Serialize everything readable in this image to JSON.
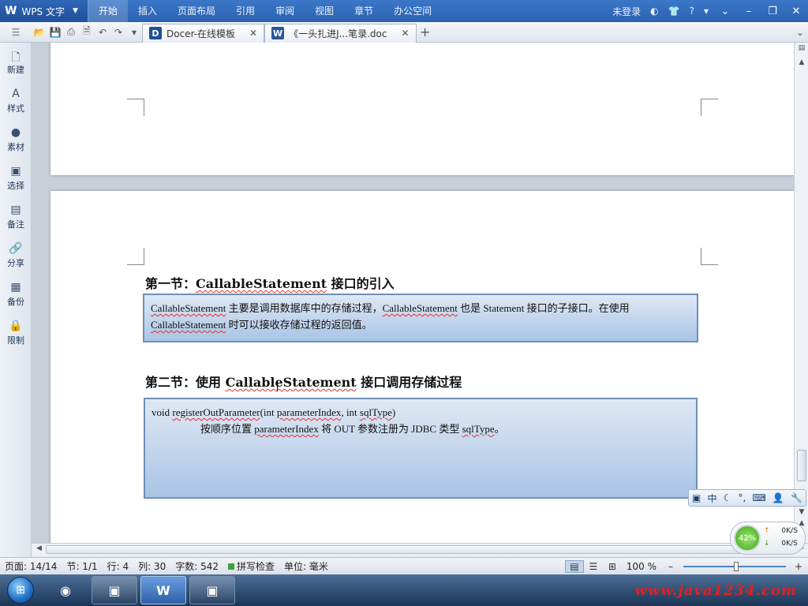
{
  "app": {
    "logo_letter": "W",
    "name": "WPS 文字",
    "menu": [
      "开始",
      "插入",
      "页面布局",
      "引用",
      "审阅",
      "视图",
      "章节",
      "办公空间"
    ],
    "active_menu": "开始",
    "login": "未登录",
    "help": "?"
  },
  "tabs": [
    {
      "icon": "D",
      "title": "Docer-在线模板"
    },
    {
      "icon": "W",
      "title": "《一头扎进J...笔录.doc"
    }
  ],
  "sidebar": [
    {
      "icon": "new-document-icon",
      "label": "新建"
    },
    {
      "icon": "style-icon",
      "label": "样式"
    },
    {
      "icon": "material-icon",
      "label": "素材"
    },
    {
      "icon": "select-icon",
      "label": "选择"
    },
    {
      "icon": "comment-icon",
      "label": "备注"
    },
    {
      "icon": "share-icon",
      "label": "分享"
    },
    {
      "icon": "backup-icon",
      "label": "备份"
    },
    {
      "icon": "restrict-icon",
      "label": "限制"
    }
  ],
  "document": {
    "section1": {
      "heading_prefix": "第一节：",
      "heading_term": "CallableStatement",
      "heading_suffix": " 接口的引入",
      "line1_term": "CallableStatement",
      "line1_a": " 主要是调用数据库中的存储过程，",
      "line1_term2": "CallableStatement",
      "line1_b": " 也是 Statement 接口的子接口。在使用",
      "line2_term": "CallableStatement",
      "line2_a": " 时可以接收存储过程的返回值。"
    },
    "section2": {
      "heading_prefix": "第二节：使用 ",
      "heading_term": "CallableStatement",
      "heading_suffix": " 接口调用存储过程",
      "sig_a": "void ",
      "sig_method": "registerOutParameter",
      "sig_b": "(int ",
      "sig_param": "parameterIndex",
      "sig_c": ", int ",
      "sig_type": "sqlType",
      "sig_d": ")",
      "desc_a": "按顺序位置  ",
      "desc_param": "parameterIndex",
      "desc_b": "  将  OUT  参数注册为  JDBC  类型  ",
      "desc_type": "sqlType",
      "desc_c": "。"
    }
  },
  "ime": {
    "lang": "中"
  },
  "network": {
    "percent": "42%",
    "up": "0K/S",
    "down": "0K/S"
  },
  "status": {
    "page": "页面: 14/14",
    "section": "节: 1/1",
    "row": "行: 4",
    "col": "列: 30",
    "words": "字数: 542",
    "spell": "拼写检查",
    "unit": "单位: 毫米",
    "zoom": "100 %",
    "zoom_level_fraction": 0.52
  },
  "taskbar": {
    "watermark": "www.java1234.com"
  }
}
